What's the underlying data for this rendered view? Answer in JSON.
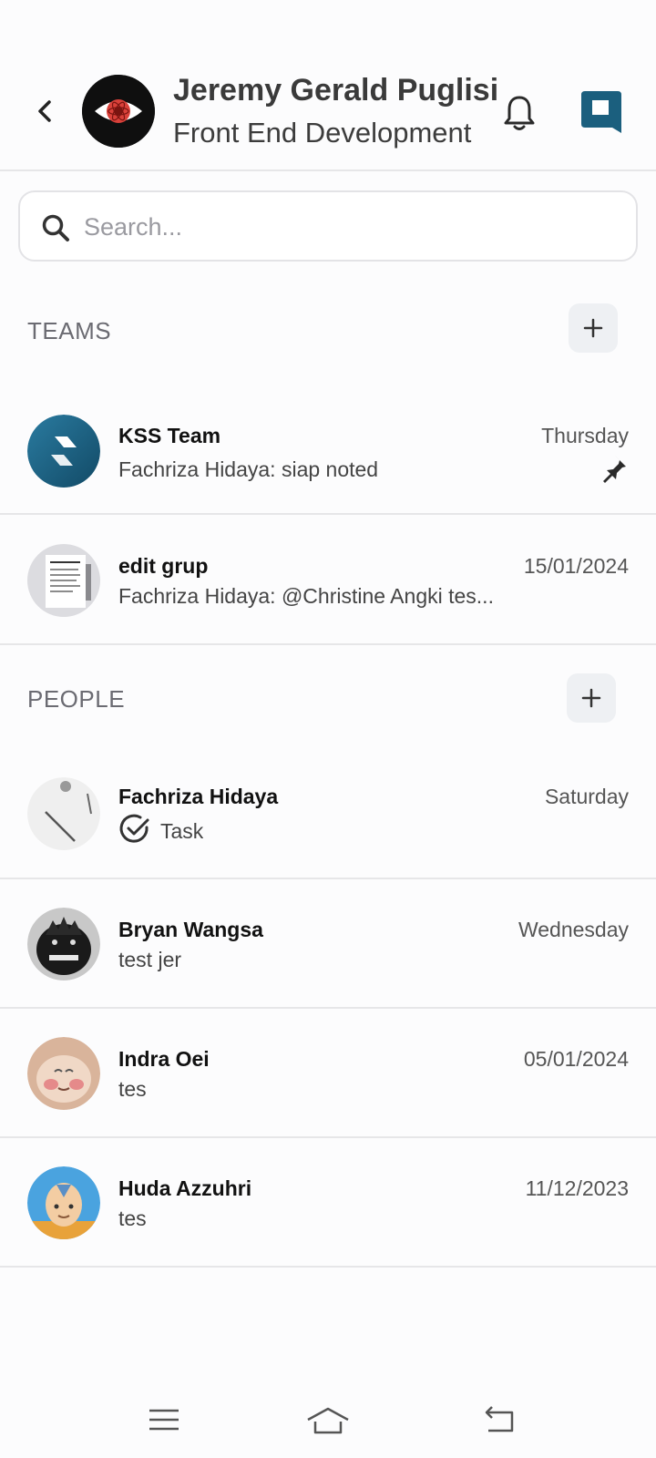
{
  "header": {
    "profile_name": "Jeremy Gerald Puglisi",
    "profile_department": "Front End Development"
  },
  "search": {
    "placeholder": "Search..."
  },
  "teams": {
    "title": "TEAMS",
    "items": [
      {
        "name": "KSS Team",
        "last_message": "Fachriza Hidaya: siap noted",
        "date": "Thursday",
        "pinned": true
      },
      {
        "name": "edit grup",
        "last_message": "Fachriza Hidaya: @Christine Angki tes...",
        "date": "15/01/2024",
        "pinned": false
      }
    ]
  },
  "people": {
    "title": "PEOPLE",
    "items": [
      {
        "name": "Fachriza Hidaya",
        "last_message": "Task",
        "date": "Saturday"
      },
      {
        "name": "Bryan Wangsa",
        "last_message": "test jer",
        "date": "Wednesday"
      },
      {
        "name": "Indra Oei",
        "last_message": "tes",
        "date": "05/01/2024"
      },
      {
        "name": "Huda Azzuhri",
        "last_message": "tes",
        "date": "11/12/2023"
      }
    ]
  },
  "colors": {
    "brand": "#1b5f7e",
    "divider": "#e6e6e8",
    "button_bg": "#eef0f3"
  },
  "icons": [
    "back-arrow-icon",
    "bell-icon",
    "app-logo-icon",
    "search-icon",
    "plus-icon",
    "pin-icon",
    "check-circle-icon",
    "menu-icon",
    "home-icon",
    "return-icon"
  ]
}
